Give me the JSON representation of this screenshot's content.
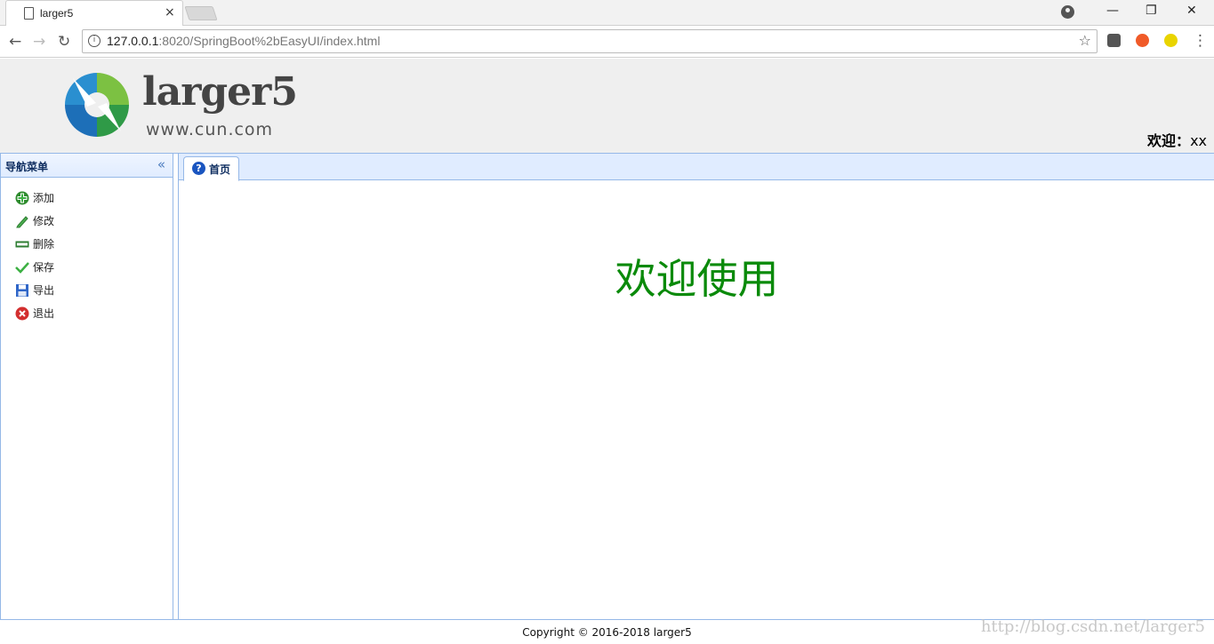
{
  "browser": {
    "tab_title": "larger5",
    "tab_close": "×",
    "url_host": "127.0.0.1",
    "url_rest": ":8020/SpringBoot%2bEasyUI/index.html",
    "back": "←",
    "forward": "→",
    "reload": "↻",
    "star": "☆",
    "minimize": "—",
    "restore": "❐",
    "close": "✕",
    "menu": "⋮"
  },
  "header": {
    "logo_name": "larger5",
    "logo_url": "www.cun.com",
    "welcome_label": "欢迎：",
    "welcome_user": "xx"
  },
  "sidebar": {
    "title": "导航菜单",
    "collapse": "«",
    "items": [
      {
        "label": "添加",
        "icon": "add-icon"
      },
      {
        "label": "修改",
        "icon": "edit-icon"
      },
      {
        "label": "删除",
        "icon": "remove-icon"
      },
      {
        "label": "保存",
        "icon": "save-icon"
      },
      {
        "label": "导出",
        "icon": "export-icon"
      },
      {
        "label": "退出",
        "icon": "exit-icon"
      }
    ]
  },
  "main": {
    "tab_label": "首页",
    "hero_text": "欢迎使用"
  },
  "footer": {
    "copyright": "Copyright © 2016-2018 larger5",
    "watermark": "http://blog.csdn.net/larger5"
  },
  "colors": {
    "accent_border": "#95b8e7",
    "hero": "#0a8a0a"
  }
}
